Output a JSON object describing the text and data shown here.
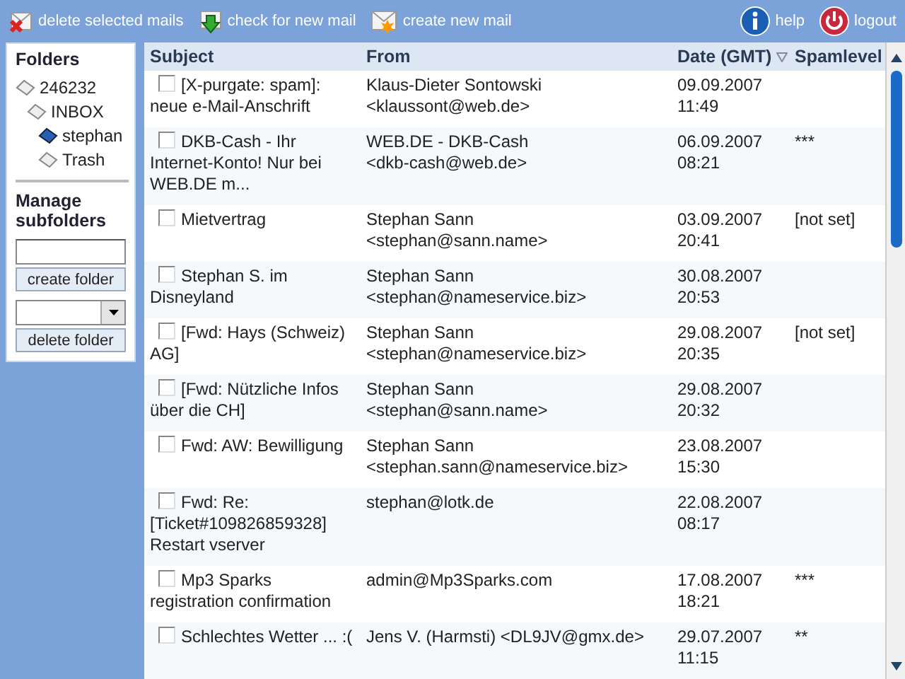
{
  "toolbar": {
    "actions": [
      {
        "kind": "delete",
        "label": "delete selected mails"
      },
      {
        "kind": "check",
        "label": "check for new mail"
      },
      {
        "kind": "create",
        "label": "create new mail"
      }
    ],
    "right_actions": [
      {
        "kind": "help",
        "label": "help"
      },
      {
        "kind": "logout",
        "label": "logout"
      }
    ]
  },
  "sidebar": {
    "folders_title": "Folders",
    "folders": [
      {
        "name": "246232",
        "selected": false,
        "children": [
          {
            "name": "INBOX",
            "selected": false,
            "children": [
              {
                "name": "stephan",
                "selected": true
              },
              {
                "name": "Trash",
                "selected": false
              }
            ]
          }
        ]
      }
    ],
    "manage_title": "Manage subfolders",
    "create_button": "create folder",
    "delete_button": "delete folder"
  },
  "table": {
    "columns": [
      {
        "label": "Subject",
        "sorted": false
      },
      {
        "label": "From",
        "sorted": false
      },
      {
        "label": "Date (GMT)",
        "sorted": true
      },
      {
        "label": "Spamlevel",
        "sorted": false
      }
    ],
    "rows": [
      {
        "checked": false,
        "subject": "[X-purgate: spam]: neue e-Mail-Anschrift",
        "from_lines": [
          "Klaus-Dieter Sontowski",
          "<klaussont@web.de>"
        ],
        "date": "09.09.2007 11:49"
      },
      {
        "checked": false,
        "subject": "DKB-Cash - Ihr Internet-Konto! Nur bei WEB.DE m...",
        "from_lines": [
          "WEB.DE - DKB-Cash",
          "<dkb-cash@web.de>"
        ],
        "date": "06.09.2007 08:21",
        "spamlevel": "***"
      },
      {
        "checked": false,
        "subject": "Mietvertrag",
        "from_lines": [
          "Stephan Sann",
          "<stephan@sann.name>"
        ],
        "date": "03.09.2007 20:41",
        "spamlevel": "[not set]"
      },
      {
        "checked": false,
        "subject": "Stephan S. im Disneyland",
        "from_lines": [
          "Stephan Sann",
          "<stephan@nameservice.biz>"
        ],
        "date": "30.08.2007 20:53"
      },
      {
        "checked": false,
        "subject": "[Fwd: Hays (Schweiz) AG]",
        "from_lines": [
          "Stephan Sann",
          "<stephan@nameservice.biz>"
        ],
        "date": "29.08.2007 20:35",
        "spamlevel": "[not set]"
      },
      {
        "checked": false,
        "subject": "[Fwd: Nützliche Infos über die CH]",
        "from_lines": [
          "Stephan Sann",
          "<stephan@sann.name>"
        ],
        "date": "29.08.2007 20:32"
      },
      {
        "checked": false,
        "subject": "Fwd: AW: Bewilligung",
        "from_lines": [
          "Stephan Sann",
          "<stephan.sann@nameservice.biz>"
        ],
        "date": "23.08.2007 15:30"
      },
      {
        "checked": false,
        "subject": "Fwd: Re: [Ticket#109826859328] Restart vserver",
        "from_lines": [
          "stephan@lotk.de"
        ],
        "date": "22.08.2007 08:17"
      },
      {
        "checked": false,
        "subject": "Mp3 Sparks registration confirmation",
        "from_lines": [
          "admin@Mp3Sparks.com"
        ],
        "date": "17.08.2007 18:21",
        "spamlevel": "***"
      },
      {
        "checked": false,
        "subject": "Schlechtes Wetter ... :(",
        "from_lines": [
          "Jens V. (Harmsti) <DL9JV@gmx.de>"
        ],
        "date": "29.07.2007 11:15",
        "spamlevel": "**"
      }
    ]
  }
}
